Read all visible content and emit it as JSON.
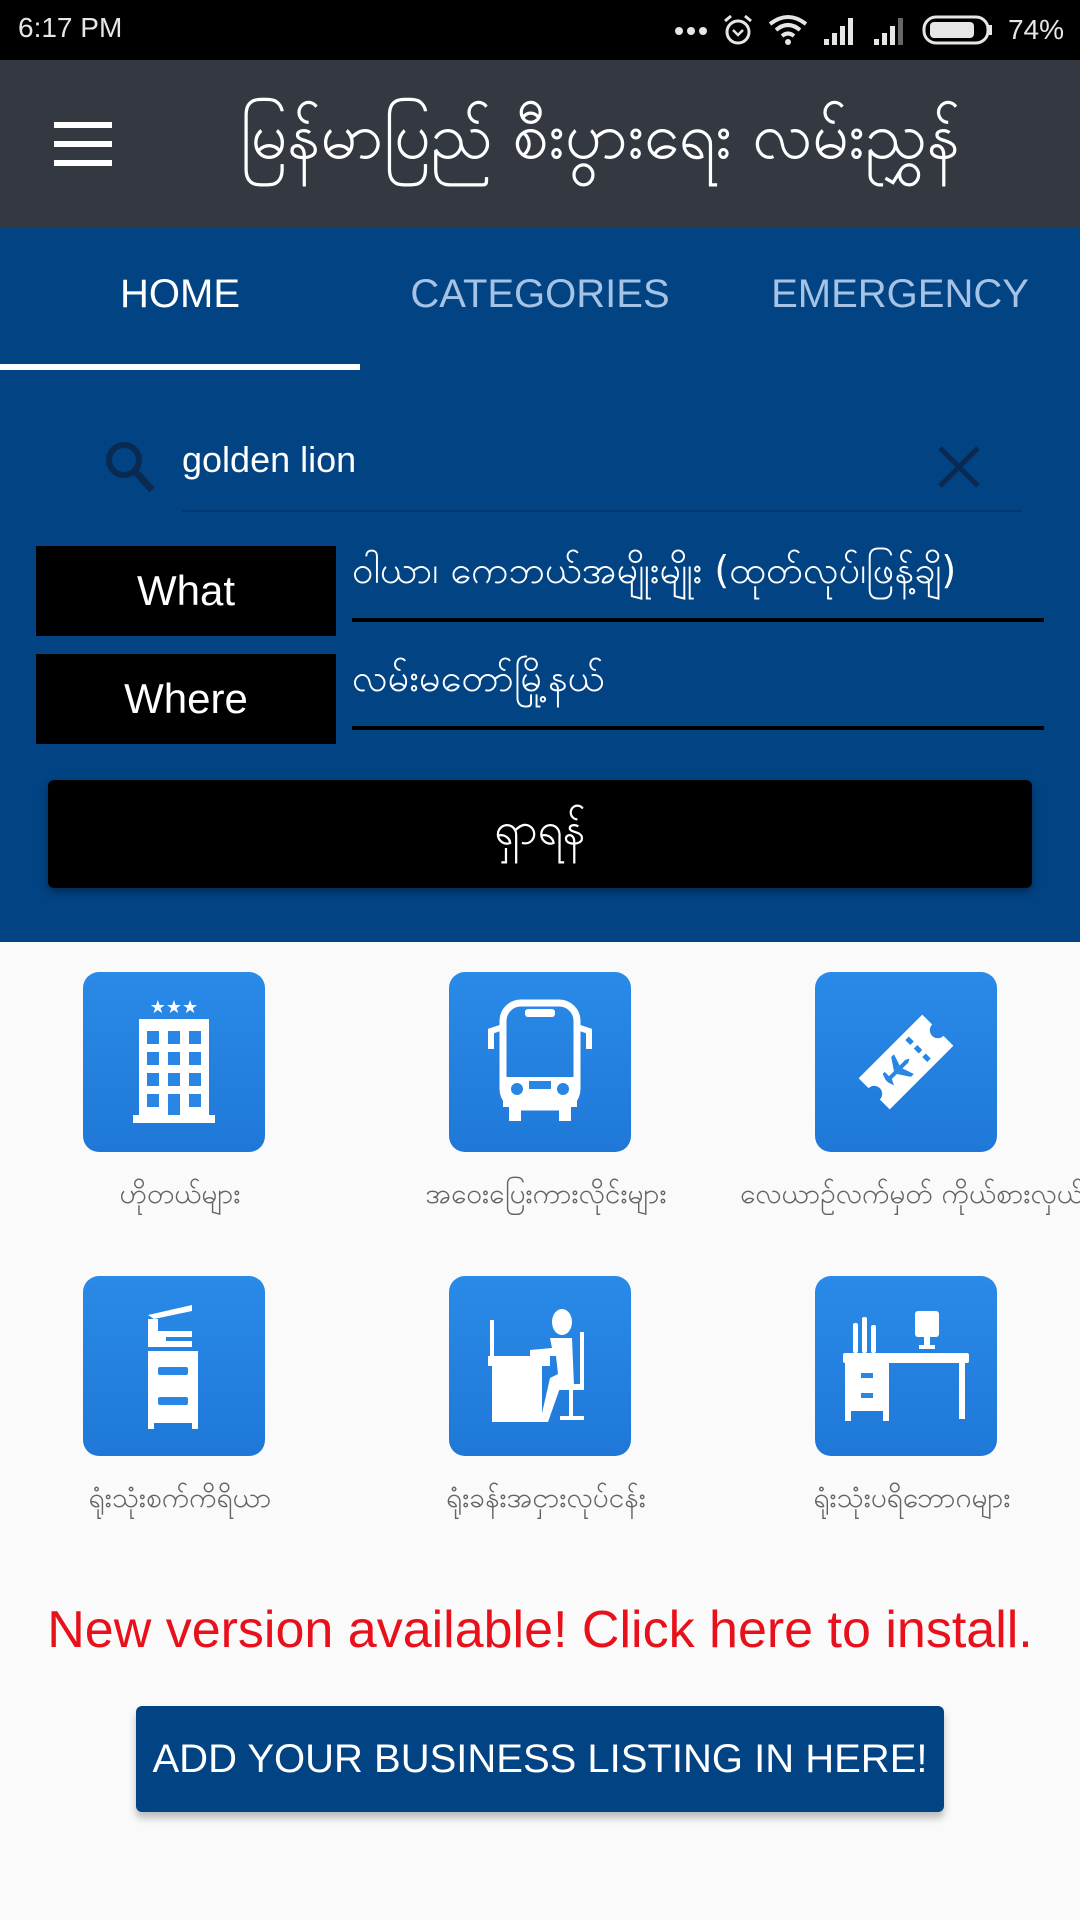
{
  "status_bar": {
    "time": "6:17 PM",
    "battery_percent": "74%",
    "battery_level": 0.74,
    "icons": [
      "more-dots-icon",
      "alarm-icon",
      "wifi-icon",
      "signal-icon",
      "signal-icon-2",
      "battery-icon"
    ]
  },
  "app_bar": {
    "title": "မြန်မာပြည် စီးပွားရေး လမ်းညွှန်",
    "menu_icon": "hamburger-menu-icon"
  },
  "tabs": [
    {
      "label": "HOME",
      "active": true
    },
    {
      "label": "CATEGORIES",
      "active": false
    },
    {
      "label": "EMERGENCY",
      "active": false
    }
  ],
  "search": {
    "value": "golden lion",
    "search_icon": "search-icon",
    "clear_icon": "close-icon"
  },
  "filters": {
    "what_label": "What",
    "what_value": "ဝါယာ၊ ကေဘယ်အမျိုးမျိုး (ထုတ်လုပ်၊ဖြန့်ချိ)",
    "where_label": "Where",
    "where_value": "လမ်းမတော်မြို့နယ်"
  },
  "search_button": "ရှာရန်",
  "categories": [
    {
      "label": "ဟိုတယ်များ",
      "icon": "hotel-icon"
    },
    {
      "label": "အဝေးပြေးကားလိုင်းများ",
      "icon": "bus-icon"
    },
    {
      "label": "လေယာဉ်လက်မှတ် ကိုယ်စားလှယ်",
      "icon": "plane-ticket-icon"
    },
    {
      "label": "ရုံးသုံးစက်ကိရိယာ",
      "icon": "copier-icon"
    },
    {
      "label": "ရုံးခန်းအငှားလုပ်ငန်း",
      "icon": "office-worker-icon"
    },
    {
      "label": "ရုံးသုံးပရိဘောဂများ",
      "icon": "office-desk-icon"
    }
  ],
  "update_notice": "New version available! Click here to install.",
  "add_listing_button": "ADD YOUR BUSINESS LISTING IN HERE!",
  "colors": {
    "primary_blue": "#024383",
    "app_bar": "#343841",
    "tile_blue": "#2585e3",
    "update_red": "#e8101a"
  }
}
